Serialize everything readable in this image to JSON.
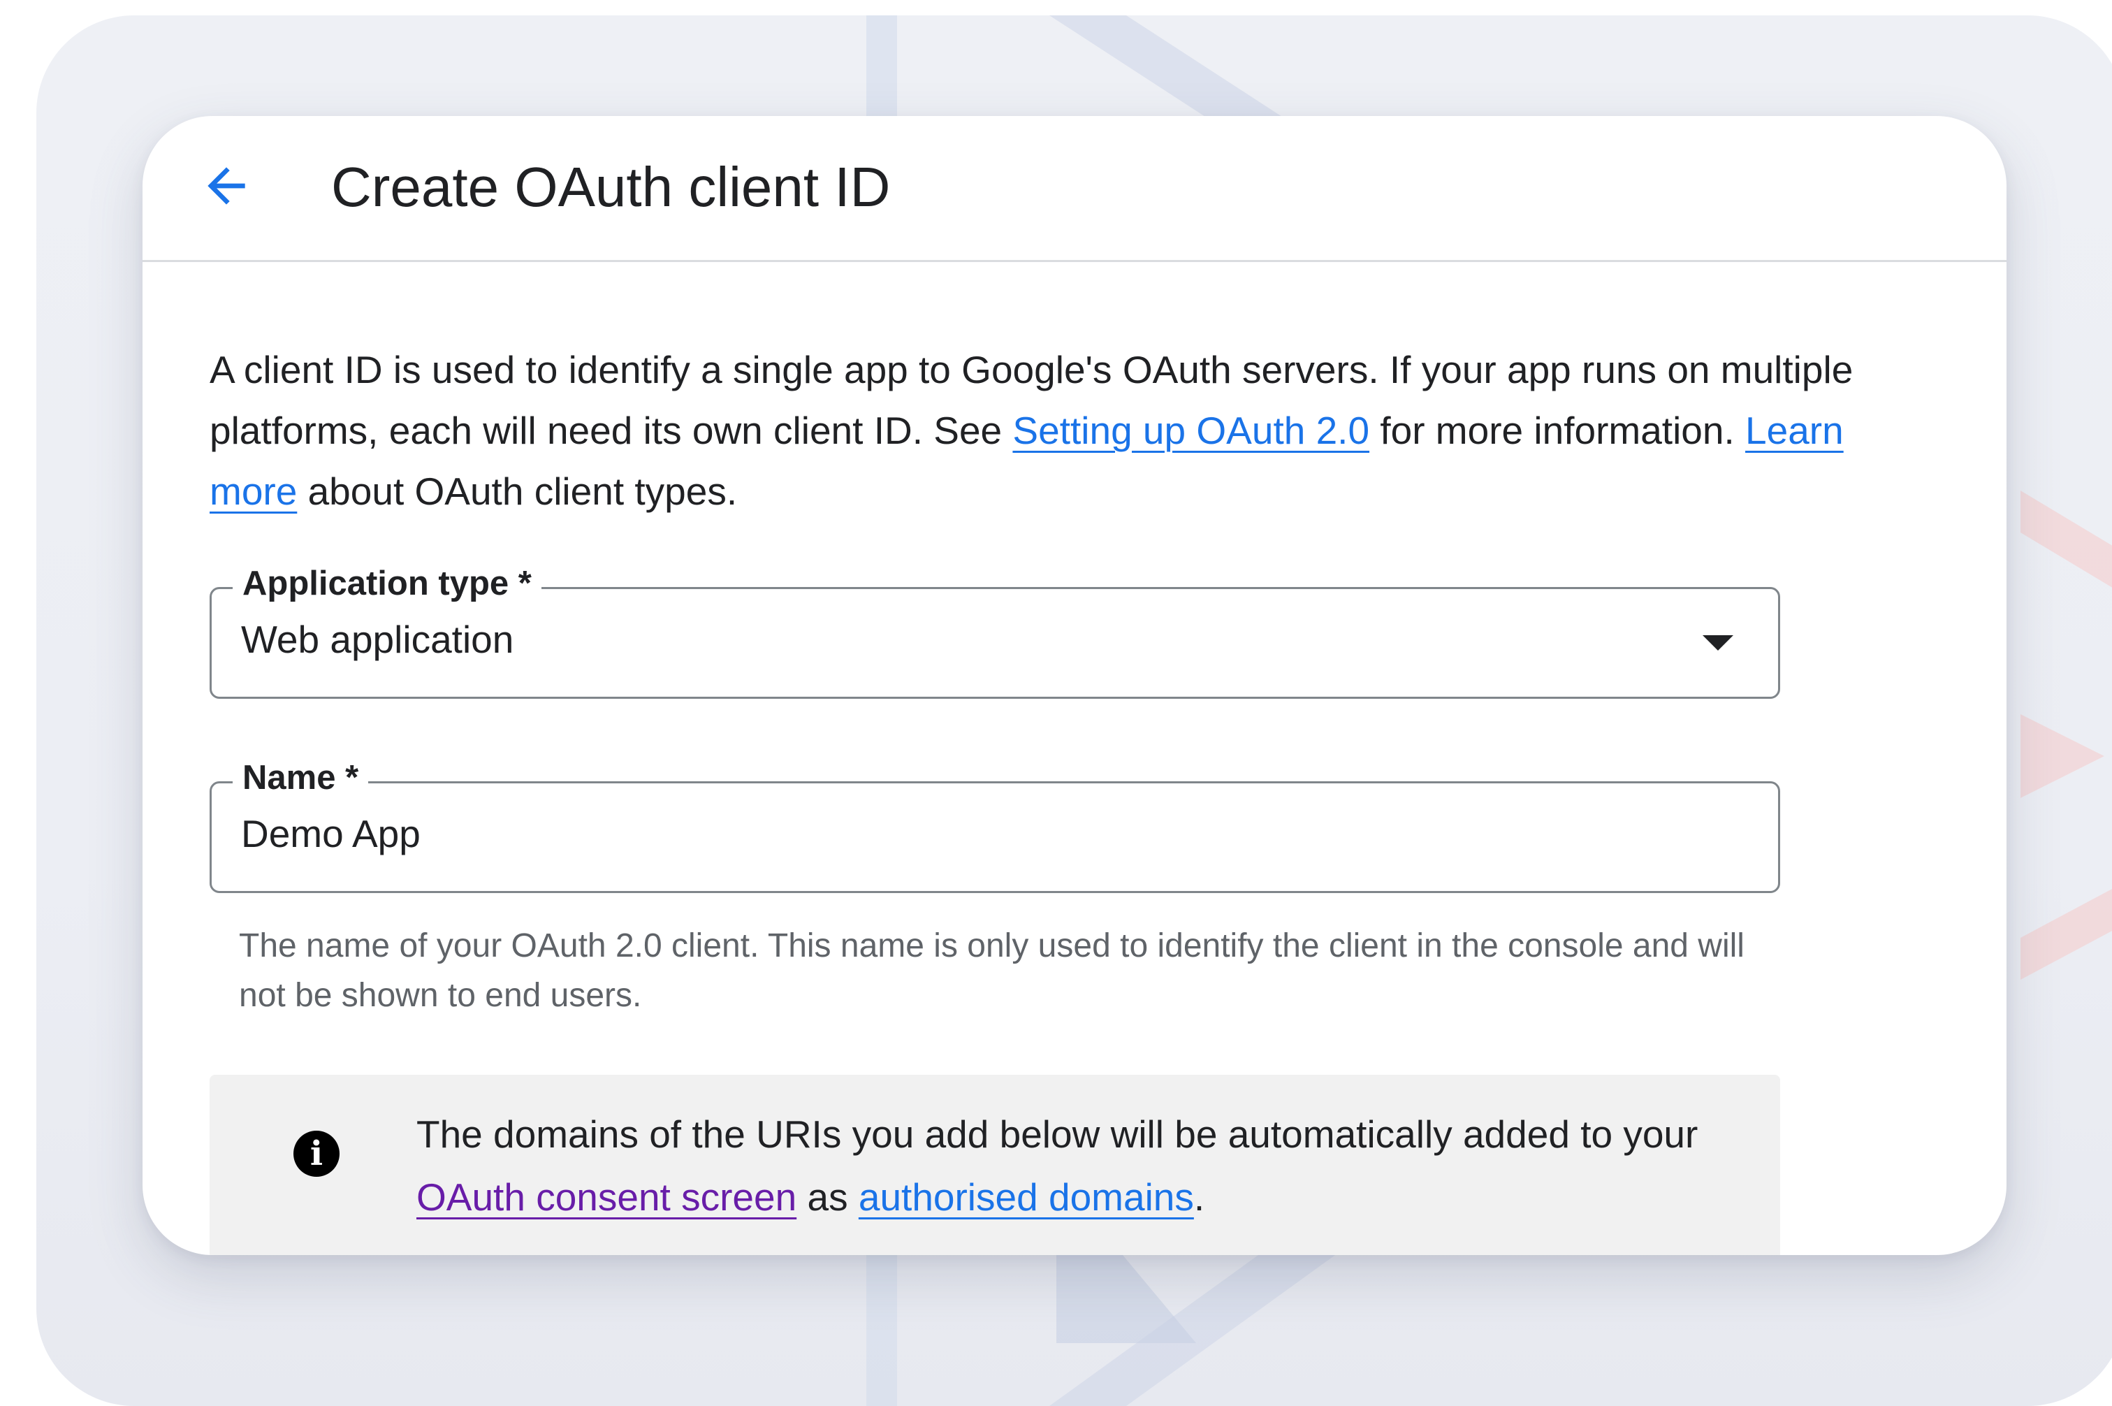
{
  "header": {
    "title": "Create OAuth client ID"
  },
  "intro": {
    "text_1": "A client ID is used to identify a single app to Google's OAuth servers. If your app runs on multiple platforms, each will need its own client ID. See ",
    "link_setup": "Setting up OAuth 2.0",
    "text_2": " for more information. ",
    "link_learn": "Learn more",
    "text_3": " about OAuth client types."
  },
  "application_type": {
    "label": "Application type *",
    "value": "Web application"
  },
  "name_field": {
    "label": "Name *",
    "value": "Demo App",
    "helper": "The name of your OAuth 2.0 client. This name is only used to identify the client in the console and will not be shown to end users."
  },
  "info_box": {
    "text_1": "The domains of the URIs you add below will be automatically added to your ",
    "link_consent": "OAuth consent screen",
    "text_2": " as ",
    "link_domains": "authorised domains",
    "text_3": "."
  },
  "icons": {
    "back": "arrow-back-icon",
    "dropdown": "chevron-down-icon",
    "info": "info-icon"
  },
  "colors": {
    "link": "#1a73e8",
    "visited_link": "#681da8",
    "text": "#202124",
    "helper": "#5f6368",
    "info_bg": "#f1f1f1"
  }
}
